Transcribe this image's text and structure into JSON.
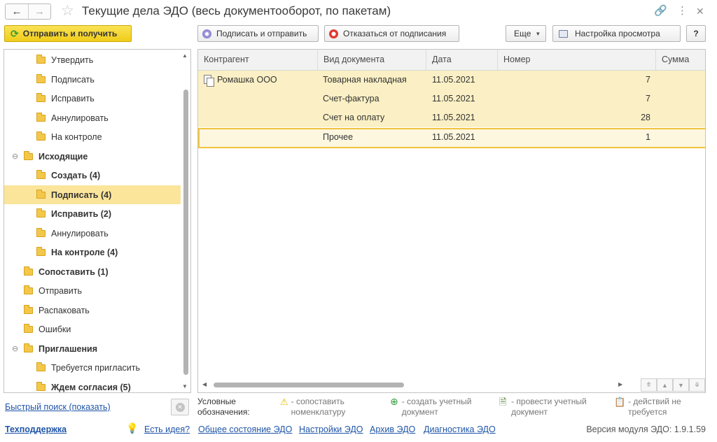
{
  "window": {
    "title": "Текущие дела ЭДО (весь документооборот, по пакетам)",
    "back_icon": "arrow-left-icon",
    "forward_icon": "arrow-right-icon",
    "favorite_icon": "star-icon",
    "link_icon": "link-icon",
    "menu_icon": "more-vertical-icon",
    "close_icon": "close-icon"
  },
  "toolbar": {
    "send_receive": "Отправить и получить",
    "sign_and_send": "Подписать и отправить",
    "refuse_sign": "Отказаться от подписания",
    "more": "Еще",
    "view_settings": "Настройка просмотра",
    "help": "?"
  },
  "tree": {
    "items": [
      {
        "label": "Утвердить",
        "level": 2,
        "bold": false
      },
      {
        "label": "Подписать",
        "level": 2,
        "bold": false
      },
      {
        "label": "Исправить",
        "level": 2,
        "bold": false
      },
      {
        "label": "Аннулировать",
        "level": 2,
        "bold": false
      },
      {
        "label": "На контроле",
        "level": 2,
        "bold": false
      },
      {
        "label": "Исходящие",
        "level": 1,
        "bold": true,
        "collapsible": true
      },
      {
        "label": "Создать (4)",
        "level": 2,
        "bold": true
      },
      {
        "label": "Подписать (4)",
        "level": 2,
        "bold": true,
        "selected": true
      },
      {
        "label": "Исправить (2)",
        "level": 2,
        "bold": true
      },
      {
        "label": "Аннулировать",
        "level": 2,
        "bold": false
      },
      {
        "label": "На контроле (4)",
        "level": 2,
        "bold": true
      },
      {
        "label": "Сопоставить (1)",
        "level": 1,
        "bold": true
      },
      {
        "label": "Отправить",
        "level": 1,
        "bold": false
      },
      {
        "label": "Распаковать",
        "level": 1,
        "bold": false
      },
      {
        "label": "Ошибки",
        "level": 1,
        "bold": false
      },
      {
        "label": "Приглашения",
        "level": 1,
        "bold": true,
        "collapsible": true
      },
      {
        "label": "Требуется пригласить",
        "level": 2,
        "bold": false
      },
      {
        "label": "Ждем согласия (5)",
        "level": 2,
        "bold": true
      }
    ]
  },
  "grid": {
    "columns": [
      "Контрагент",
      "Вид документа",
      "Дата",
      "Номер",
      "Сумма"
    ],
    "rows": [
      {
        "counterparty": "Ромашка ООО",
        "doc_type": "Товарная накладная",
        "date": "11.05.2021",
        "number": "7",
        "sum": ""
      },
      {
        "counterparty": "",
        "doc_type": "Счет-фактура",
        "date": "11.05.2021",
        "number": "7",
        "sum": ""
      },
      {
        "counterparty": "",
        "doc_type": "Счет на оплату",
        "date": "11.05.2021",
        "number": "28",
        "sum": ""
      },
      {
        "counterparty": "",
        "doc_type": "Прочее",
        "date": "11.05.2021",
        "number": "1",
        "sum": ""
      }
    ]
  },
  "footer": {
    "quick_search": "Быстрый поиск (показать)",
    "legend_title": "Условные обозначения:",
    "legend": [
      {
        "icon": "warning-icon",
        "text": "- сопоставить номенклатуру"
      },
      {
        "icon": "plus-circle-icon",
        "text": "- создать учетный документ"
      },
      {
        "icon": "post-document-icon",
        "text": "- провести учетный документ"
      },
      {
        "icon": "clipboard-check-icon",
        "text": "- действий не требуется"
      }
    ],
    "support": "Техподдержка",
    "links": [
      "Есть идея?",
      "Общее состояние ЭДО",
      "Настройки ЭДО",
      "Архив ЭДО",
      "Диагностика ЭДО"
    ],
    "version": "Версия модуля ЭДО: 1.9.1.59"
  }
}
